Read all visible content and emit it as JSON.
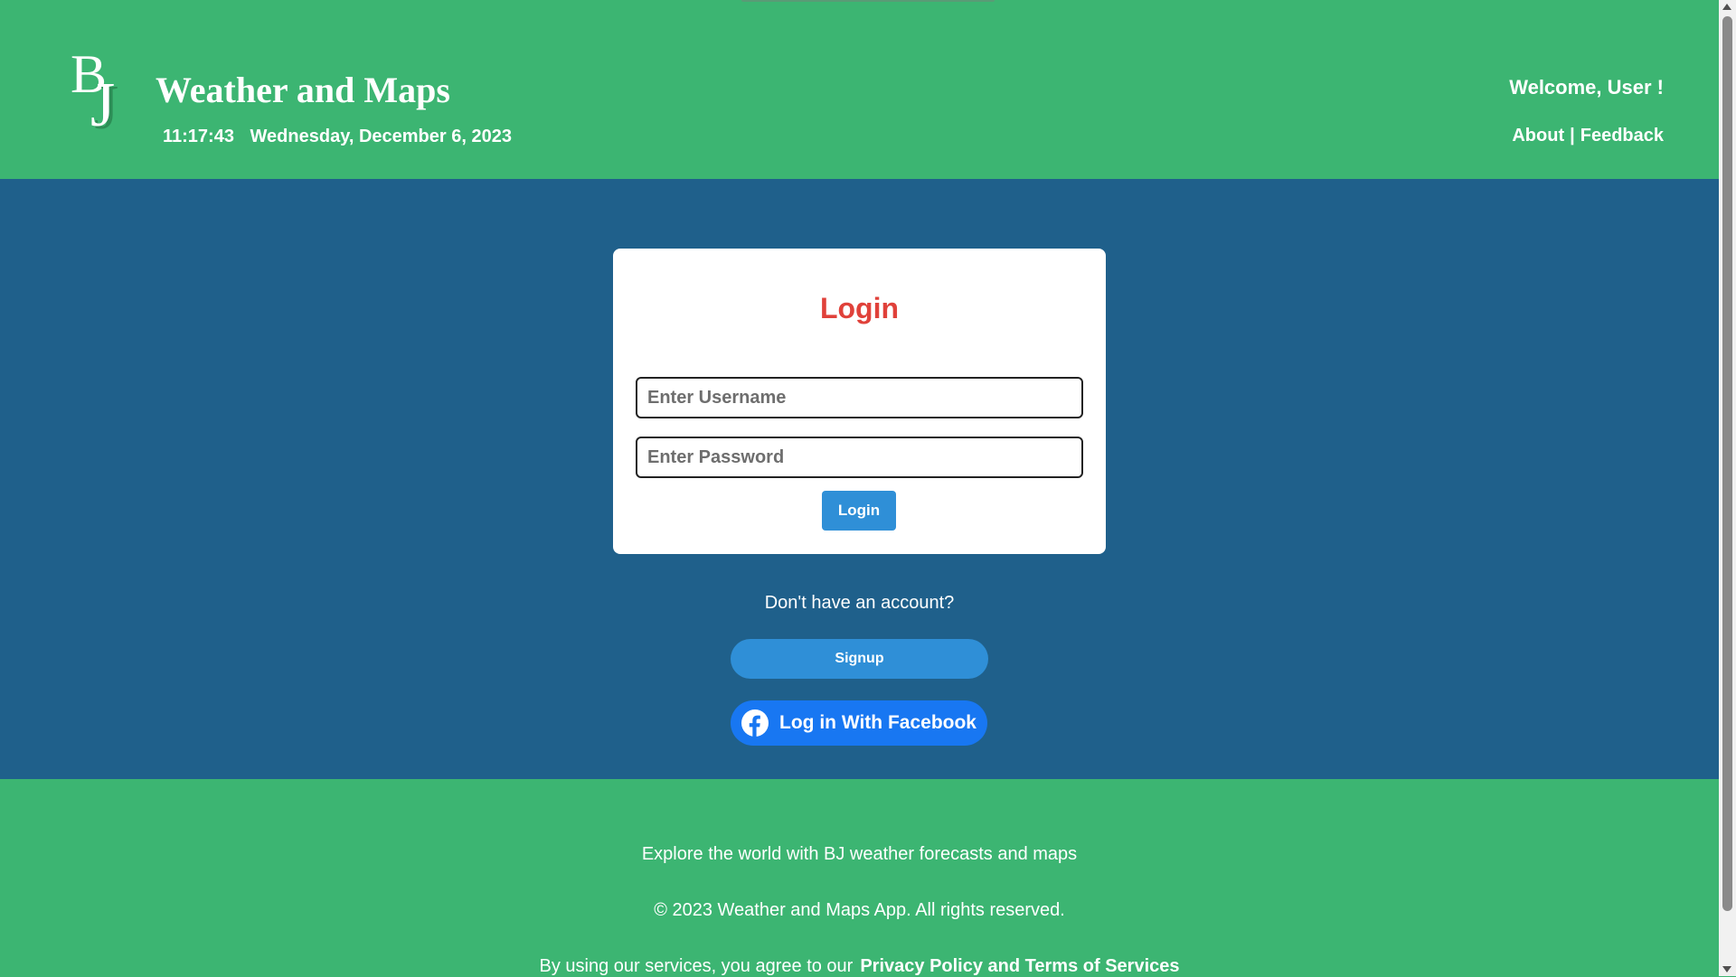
{
  "header": {
    "logo_text": "BJ",
    "title": "Weather and Maps",
    "time": "11:17:43",
    "date": "Wednesday, December 6, 2023",
    "welcome": "Welcome, User !",
    "nav": {
      "about": "About",
      "separator": "|",
      "feedback": "Feedback"
    }
  },
  "login": {
    "title": "Login",
    "username_placeholder": "Enter Username",
    "password_placeholder": "Enter Password",
    "button": "Login"
  },
  "signup": {
    "prompt": "Don't have an account?",
    "button": "Signup"
  },
  "facebook": {
    "button": "Log in With Facebook",
    "icon": "facebook-icon"
  },
  "footer": {
    "line1": "Explore the world with BJ weather forecasts and maps",
    "line2": "© 2023 Weather and Maps App. All rights reserved.",
    "line3": "By using our services, you agree to our",
    "policy_link": "Privacy Policy and Terms of Services"
  },
  "colors": {
    "header_bg": "#3cb572",
    "main_bg": "#1f608b",
    "accent": "#2f8fd7",
    "login_title": "#e0413a",
    "facebook": "#1877f2"
  }
}
